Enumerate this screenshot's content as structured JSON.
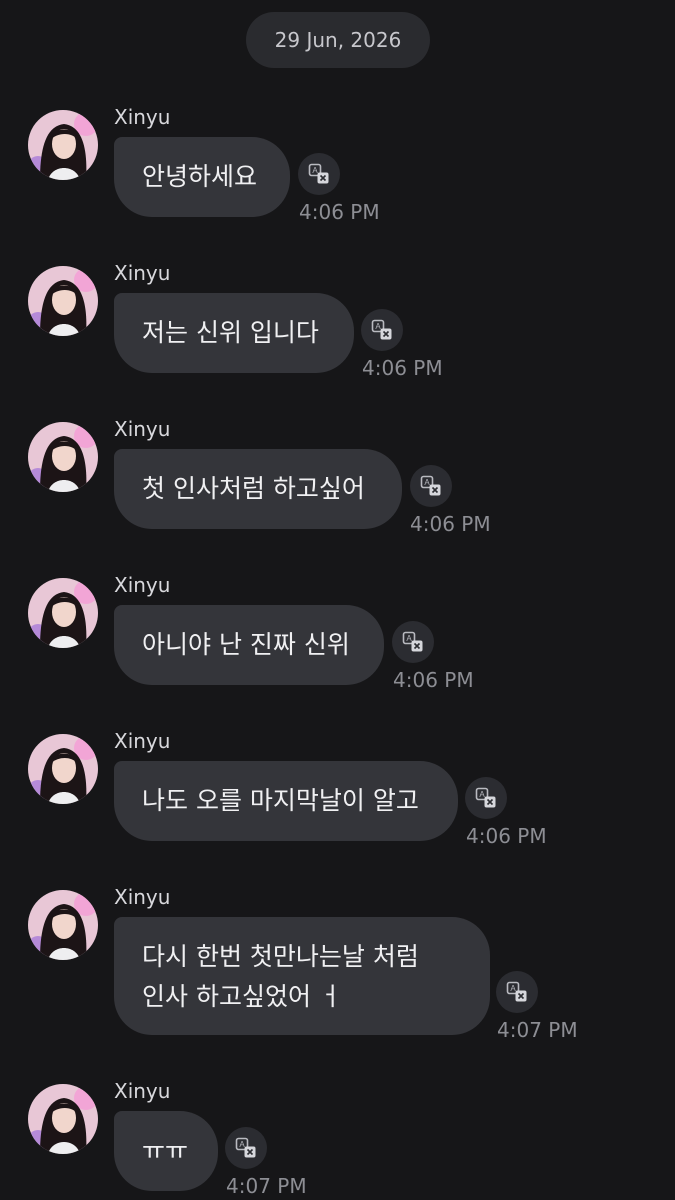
{
  "date_divider": "29 Jun, 2026",
  "messages": [
    {
      "sender": "Xinyu",
      "text": "안녕하세요",
      "time": "4:06 PM"
    },
    {
      "sender": "Xinyu",
      "text": "저는 신위 입니다",
      "time": "4:06 PM"
    },
    {
      "sender": "Xinyu",
      "text": "첫 인사처럼 하고싶어",
      "time": "4:06 PM"
    },
    {
      "sender": "Xinyu",
      "text": "아니야 난 진짜 신위",
      "time": "4:06 PM"
    },
    {
      "sender": "Xinyu",
      "text": "나도 오를 마지막날이 알고",
      "time": "4:06 PM"
    },
    {
      "sender": "Xinyu",
      "text": "다시 한번 첫만나는날 처럼\n인사 하고싶었어 ㅓ",
      "time": "4:07 PM"
    },
    {
      "sender": "Xinyu",
      "text": "ㅠㅠ",
      "time": "4:07 PM"
    }
  ],
  "icons": {
    "translate": "translate-icon",
    "avatar": "avatar-photo"
  },
  "colors": {
    "background": "#161618",
    "bubble": "#34353a",
    "date_pill": "#2a2b2f",
    "timestamp": "#8d8e94"
  }
}
